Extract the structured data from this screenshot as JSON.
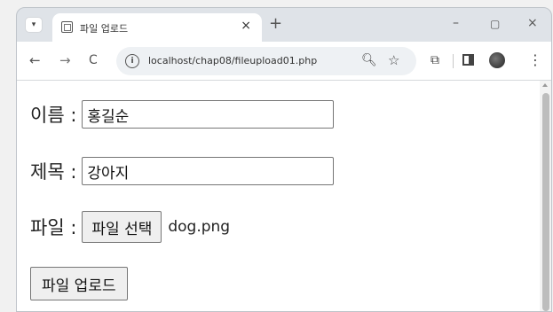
{
  "browser": {
    "tab_title": "파일 업로드",
    "tab_close": "×",
    "new_tab": "+",
    "window_controls": {
      "minimize": "–",
      "maximize": "▢",
      "close": "×"
    },
    "nav": {
      "back": "←",
      "forward": "→",
      "reload": "C"
    },
    "url": "localhost/chap08/fileupload01.php",
    "icons": [
      "tab-search-icon",
      "favicon-icon",
      "site-info-icon",
      "zoom-icon",
      "star-icon",
      "extensions-icon",
      "side-panel-icon",
      "profile-icon",
      "menu-icon"
    ]
  },
  "form": {
    "name_label": "이름 :",
    "name_value": "홍길순",
    "title_label": "제목 :",
    "title_value": "강아지",
    "file_label": "파일 :",
    "file_button": "파일 선택",
    "file_name": "dog.png",
    "submit_button": "파일 업로드"
  }
}
